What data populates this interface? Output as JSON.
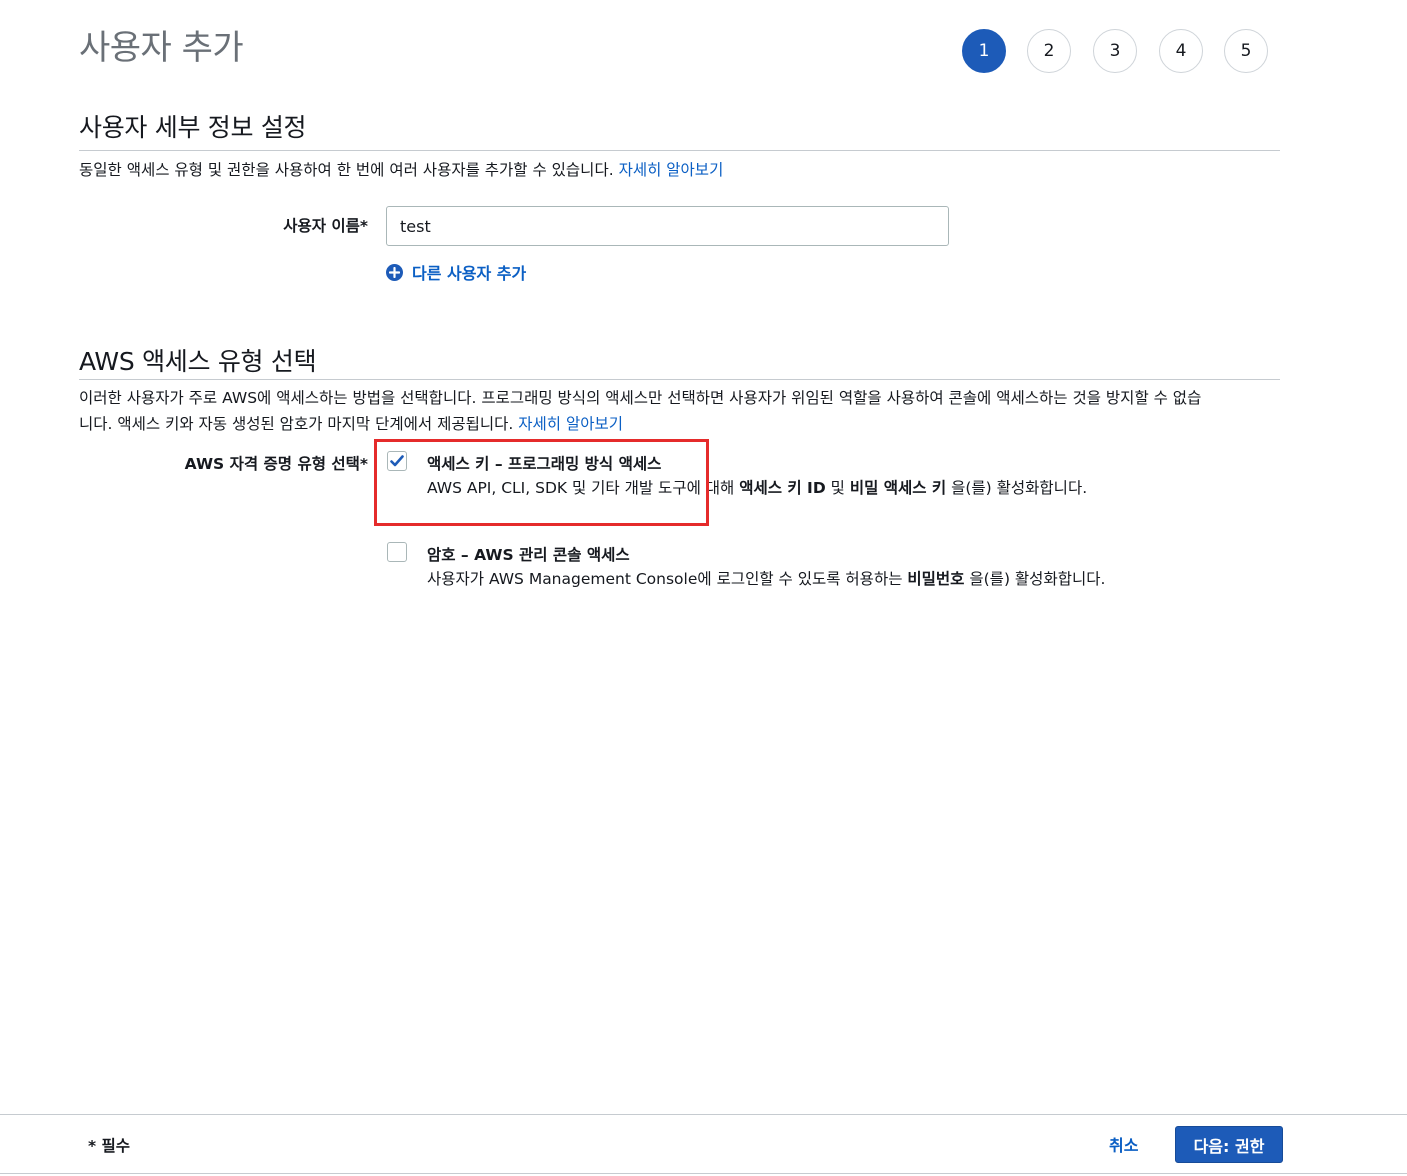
{
  "page": {
    "title": "사용자 추가"
  },
  "steps": [
    "1",
    "2",
    "3",
    "4",
    "5"
  ],
  "active_step": 1,
  "details": {
    "title": "사용자 세부 정보 설정",
    "description": "동일한 액세스 유형 및 권한을 사용하여 한 번에 여러 사용자를 추가할 수 있습니다.",
    "learn_more": "자세히 알아보기",
    "username_label": "사용자 이름*",
    "username_value": "test",
    "add_user_label": "다른 사용자 추가"
  },
  "access": {
    "title": "AWS 액세스 유형 선택",
    "description_line1": "이러한 사용자가 주로 AWS에 액세스하는 방법을 선택합니다. 프로그래밍 방식의 액세스만 선택하면 사용자가 위임된 역할을 사용하여 콘솔에 액세스하는 것을 방지할 수 없습",
    "description_line2": "니다. 액세스 키와 자동 생성된 암호가 마지막 단계에서 제공됩니다.",
    "learn_more": "자세히 알아보기",
    "credential_label": "AWS 자격 증명 유형 선택*",
    "options": [
      {
        "title": "액세스 키 – 프로그래밍 방식 액세스",
        "checked": true,
        "desc_prefix": "AWS API, CLI, SDK 및 기타 개발 도구에 대해 ",
        "desc_bold1": "액세스 키 ID",
        "desc_mid": " 및 ",
        "desc_bold2": "비밀 액세스 키",
        "desc_suffix": " 을(를) 활성화합니다."
      },
      {
        "title": "암호 – AWS 관리 콘솔 액세스",
        "checked": false,
        "desc_prefix": "사용자가 AWS Management Console에 로그인할 수 있도록 허용하는 ",
        "desc_bold1": "비밀번호",
        "desc_suffix": " 을(를) 활성화합니다."
      }
    ]
  },
  "footer": {
    "required_note": "* 필수",
    "cancel_label": "취소",
    "next_label": "다음: 권한"
  },
  "colors": {
    "primary": "#1d5bb8",
    "link": "#0b5fc4",
    "highlight": "#e52b2b"
  }
}
